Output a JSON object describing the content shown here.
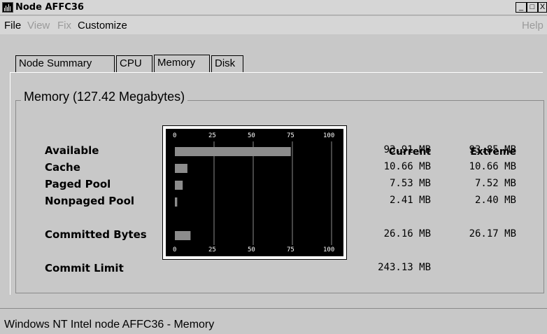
{
  "window": {
    "title": "Node AFFC36",
    "min_label": "_",
    "max_label": "□",
    "close_label": "X"
  },
  "menu": {
    "file": "File",
    "view": "View",
    "fix": "Fix",
    "customize": "Customize",
    "help": "Help"
  },
  "tabs": [
    "Node Summary",
    "CPU",
    "Memory",
    "Disk"
  ],
  "active_tab": "Memory",
  "group": {
    "title": "Memory  (127.42 Megabytes)"
  },
  "columns": {
    "current": "Current",
    "extreme": "Extreme"
  },
  "rows": [
    {
      "label": "Available",
      "current": "93.91 MB",
      "extreme": "93.85 MB"
    },
    {
      "label": "Cache",
      "current": "10.66 MB",
      "extreme": "10.66 MB"
    },
    {
      "label": "Paged Pool",
      "current": "7.53 MB",
      "extreme": "7.52 MB"
    },
    {
      "label": "Nonpaged Pool",
      "current": "2.41 MB",
      "extreme": "2.40 MB"
    },
    {
      "label": "Committed Bytes",
      "current": "26.16 MB",
      "extreme": "26.17 MB"
    },
    {
      "label": "Commit Limit",
      "current": "243.13 MB",
      "extreme": ""
    }
  ],
  "chart_data": {
    "type": "bar",
    "orientation": "horizontal",
    "categories": [
      "Available",
      "Cache",
      "Paged Pool",
      "Nonpaged Pool",
      "Committed Bytes"
    ],
    "values": [
      74,
      8,
      5,
      1.5,
      10
    ],
    "xlim": [
      0,
      100
    ],
    "ticks": [
      "0",
      "25",
      "50",
      "75",
      "100"
    ],
    "grid": true,
    "bar_color": "#8c8c8c",
    "background": "#000000"
  },
  "status": {
    "text": "Windows NT Intel node AFFC36 - Memory"
  },
  "colors": {
    "window_bg": "#c8c8c8",
    "chart_bg": "#000000",
    "bar": "#8c8c8c"
  }
}
